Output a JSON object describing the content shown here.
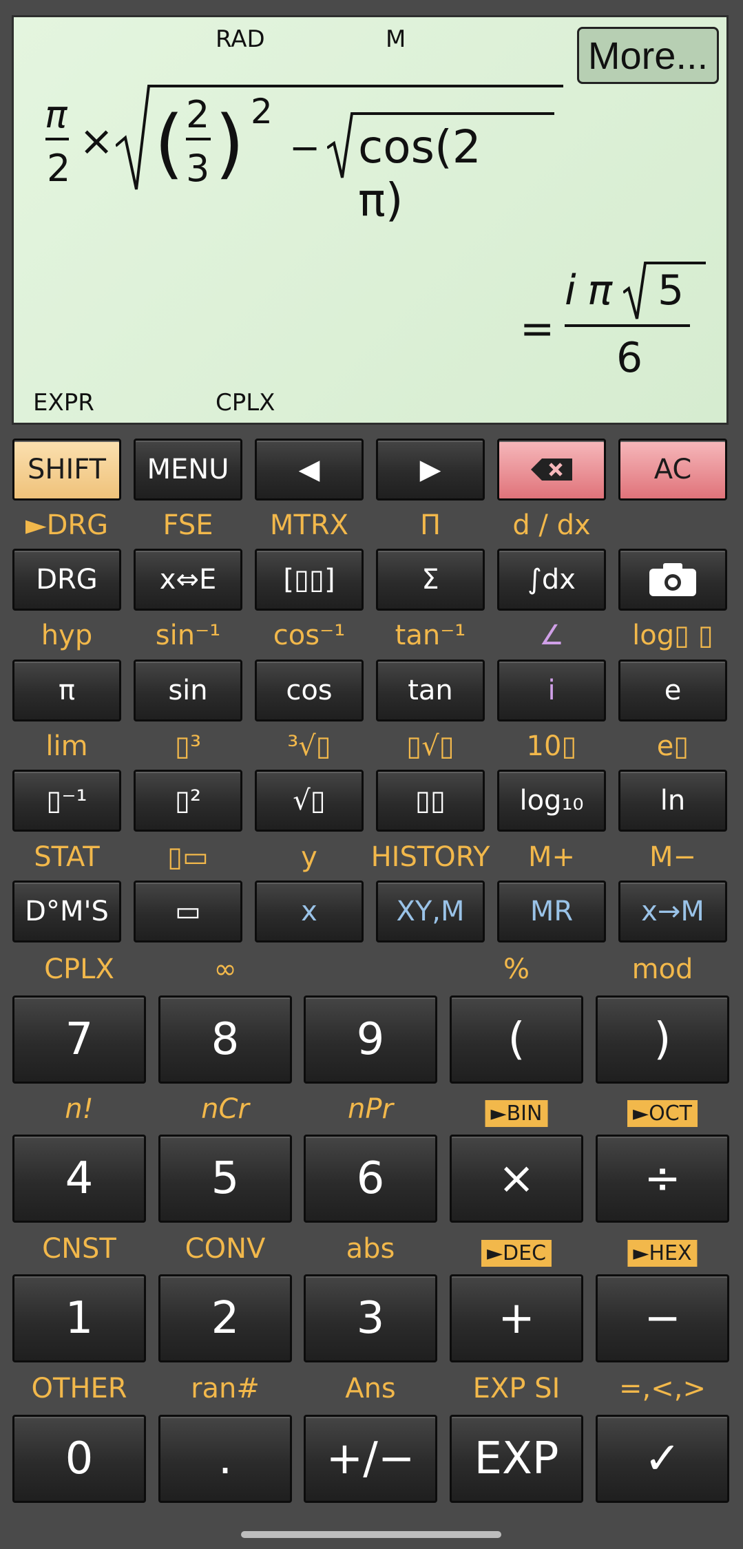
{
  "display": {
    "indicators": {
      "angle": "RAD",
      "memory": "M",
      "mode": "EXPR",
      "complex": "CPLX"
    },
    "more_label": "More...",
    "expression": {
      "pi": "π",
      "two": "2",
      "times": "×",
      "num": "2",
      "den": "3",
      "lparen": "(",
      "rparen": ")",
      "exp": "2",
      "minus": "−",
      "cos_text": "cos(2 π)"
    },
    "result": {
      "equals": "=",
      "i": "i",
      "pi": "π",
      "five": "5",
      "den": "6"
    }
  },
  "keypad": {
    "row1": [
      "SHIFT",
      "MENU",
      "◀",
      "▶",
      "⌫",
      "AC"
    ],
    "labels2": [
      "►DRG",
      "FSE",
      "MTRX",
      "Π",
      "d / dx",
      ""
    ],
    "row2": [
      "DRG",
      "x⇔E",
      "[▯▯]",
      "Σ",
      "∫dx",
      "camera"
    ],
    "labels3": [
      "hyp",
      "sin⁻¹",
      "cos⁻¹",
      "tan⁻¹",
      "∠",
      "log▯ ▯"
    ],
    "row3": [
      "π",
      "sin",
      "cos",
      "tan",
      "i",
      "e"
    ],
    "labels4": [
      "lim",
      "▯³",
      "³√▯",
      "▯√▯",
      "10▯",
      "e▯"
    ],
    "row4": [
      "▯⁻¹",
      "▯²",
      "√▯",
      "▯▯",
      "log₁₀",
      "ln"
    ],
    "labels5": [
      "STAT",
      "▯▭",
      "y",
      "HISTORY",
      "M+",
      "M−"
    ],
    "row5": [
      "D°M'S",
      "▭",
      "x",
      "XY,M",
      "MR",
      "x→M"
    ],
    "labels6": [
      "CPLX",
      "∞",
      "",
      "%",
      "mod"
    ],
    "row6": [
      "7",
      "8",
      "9",
      "(",
      ")"
    ],
    "labels7": [
      "n!",
      "nCr",
      "nPr",
      "►BIN",
      "►OCT"
    ],
    "row7": [
      "4",
      "5",
      "6",
      "×",
      "÷"
    ],
    "labels8": [
      "CNST",
      "CONV",
      "abs",
      "►DEC",
      "►HEX"
    ],
    "row8": [
      "1",
      "2",
      "3",
      "+",
      "−"
    ],
    "labels9": [
      "OTHER",
      "ran#",
      "Ans",
      "EXP SI",
      "=,<,>"
    ],
    "row9": [
      "0",
      ".",
      "+/−",
      "EXP",
      "✓"
    ]
  }
}
